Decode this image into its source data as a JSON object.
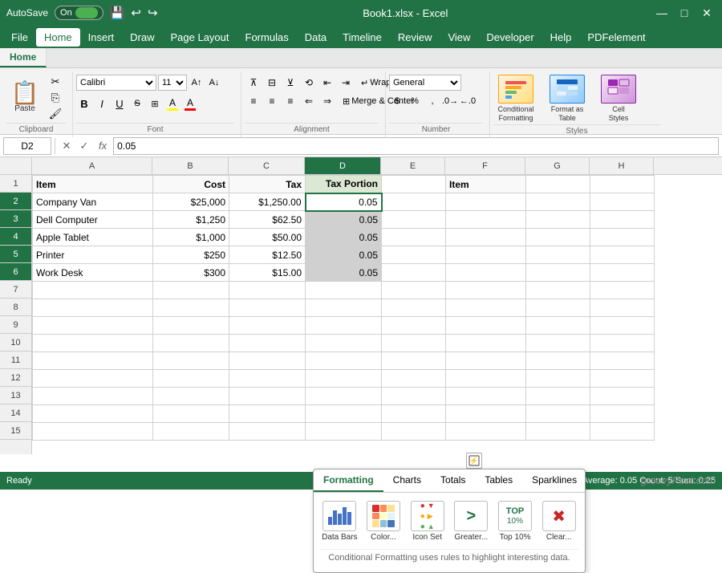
{
  "titlebar": {
    "autosave": "AutoSave",
    "autosave_state": "On",
    "filename": "Book1.xlsx - Excel",
    "minimize": "—",
    "maximize": "□",
    "close": "✕"
  },
  "menubar": {
    "items": [
      "File",
      "Home",
      "Insert",
      "Draw",
      "Page Layout",
      "Formulas",
      "Data",
      "Timeline",
      "Review",
      "View",
      "Developer",
      "Help",
      "PDFelement"
    ]
  },
  "ribbon": {
    "tabs": [
      "Home"
    ],
    "groups": {
      "clipboard": "Clipboard",
      "font": "Font",
      "alignment": "Alignment",
      "number": "Number",
      "styles": "Styles"
    },
    "font": {
      "name": "Calibri",
      "size": "11",
      "bold": "B",
      "italic": "I",
      "underline": "U",
      "strikethrough": "S"
    },
    "alignment": {
      "wrap_text": "Wrap Text",
      "merge_center": "Merge & Center"
    },
    "number": {
      "format": "General"
    },
    "styles": {
      "conditional": "Conditional\nFormatting",
      "format_table": "Format as\nTable",
      "cell_styles": "Cell\nStyles"
    }
  },
  "formulabar": {
    "cell_ref": "D2",
    "formula_value": "0.05"
  },
  "columns": [
    "A",
    "B",
    "C",
    "D",
    "E",
    "F",
    "G",
    "H"
  ],
  "rows": [
    1,
    2,
    3,
    4,
    5,
    6,
    7,
    8,
    9,
    10,
    11,
    12,
    13,
    14,
    15
  ],
  "spreadsheet": {
    "headers": [
      "Item",
      "Cost",
      "Tax",
      "Tax Portion",
      "",
      "Item",
      "",
      ""
    ],
    "data": [
      [
        "Company Van",
        "$25,000",
        "$1,250.00",
        "0.05",
        "",
        "",
        "",
        ""
      ],
      [
        "Dell Computer",
        "$1,250",
        "$62.50",
        "0.05",
        "",
        "",
        "",
        ""
      ],
      [
        "Apple Tablet",
        "$1,000",
        "$50.00",
        "0.05",
        "",
        "",
        "",
        ""
      ],
      [
        "Printer",
        "$250",
        "$12.50",
        "0.05",
        "",
        "",
        "",
        ""
      ],
      [
        "Work Desk",
        "$300",
        "$15.00",
        "0.05",
        "",
        "",
        "",
        ""
      ],
      [
        "",
        "",
        "",
        "",
        "",
        "",
        "",
        ""
      ],
      [
        "",
        "",
        "",
        "",
        "",
        "",
        "",
        ""
      ],
      [
        "",
        "",
        "",
        "",
        "",
        "",
        "",
        ""
      ],
      [
        "",
        "",
        "",
        "",
        "",
        "",
        "",
        ""
      ],
      [
        "",
        "",
        "",
        "",
        "",
        "",
        "",
        ""
      ],
      [
        "",
        "",
        "",
        "",
        "",
        "",
        "",
        ""
      ],
      [
        "",
        "",
        "",
        "",
        "",
        "",
        "",
        ""
      ],
      [
        "",
        "",
        "",
        "",
        "",
        "",
        "",
        ""
      ],
      [
        "",
        "",
        "",
        "",
        "",
        "",
        "",
        ""
      ]
    ]
  },
  "quick_analysis": {
    "tabs": [
      "Formatting",
      "Charts",
      "Totals",
      "Tables",
      "Sparklines"
    ],
    "active_tab": "Formatting",
    "icons": [
      {
        "label": "Data Bars",
        "icon": "databars"
      },
      {
        "label": "Color...",
        "icon": "color"
      },
      {
        "label": "Icon Set",
        "icon": "iconset"
      },
      {
        "label": "Greater...",
        "icon": "greater"
      },
      {
        "label": "Top 10%",
        "icon": "top10"
      },
      {
        "label": "Clear...",
        "icon": "clear"
      }
    ],
    "description": "Conditional Formatting uses rules to highlight interesting data."
  },
  "statusbar": {
    "left": "Ready",
    "right": "Average: 0.05   Count: 5   Sum: 0.25"
  },
  "watermark": "groovyPost.com"
}
